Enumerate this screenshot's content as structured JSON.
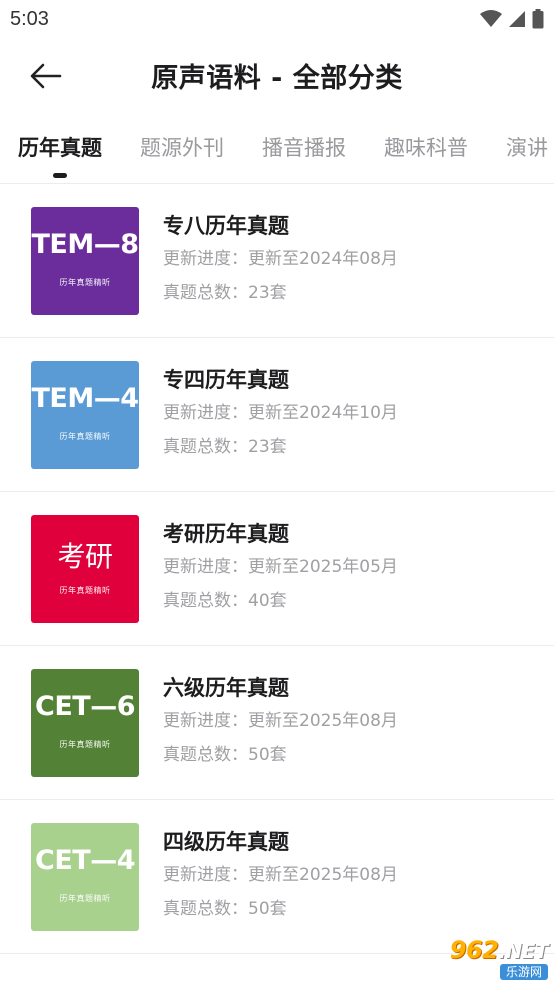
{
  "status_bar": {
    "time": "5:03"
  },
  "header": {
    "title": "原声语料 - 全部分类"
  },
  "tabs": [
    {
      "label": "历年真题",
      "active": true
    },
    {
      "label": "题源外刊",
      "active": false
    },
    {
      "label": "播音播报",
      "active": false
    },
    {
      "label": "趣味科普",
      "active": false
    },
    {
      "label": "演讲",
      "active": false
    }
  ],
  "items": [
    {
      "cover_title": "TEM—8",
      "cover_subtitle": "历年真题精听",
      "cover_color": "#6a2d9b",
      "title": "专八历年真题",
      "progress": "更新进度：更新至2024年08月",
      "count": "真题总数：23套"
    },
    {
      "cover_title": "TEM—4",
      "cover_subtitle": "历年真题精听",
      "cover_color": "#5b9bd5",
      "title": "专四历年真题",
      "progress": "更新进度：更新至2024年10月",
      "count": "真题总数：23套"
    },
    {
      "cover_title": "考研",
      "cover_subtitle": "历年真题精听",
      "cover_color": "#e0003b",
      "title": "考研历年真题",
      "progress": "更新进度：更新至2025年05月",
      "count": "真题总数：40套"
    },
    {
      "cover_title": "CET—6",
      "cover_subtitle": "历年真题精听",
      "cover_color": "#538135",
      "title": "六级历年真题",
      "progress": "更新进度：更新至2025年08月",
      "count": "真题总数：50套"
    },
    {
      "cover_title": "CET—4",
      "cover_subtitle": "历年真题精听",
      "cover_color": "#a9d18e",
      "title": "四级历年真题",
      "progress": "更新进度：更新至2025年08月",
      "count": "真题总数：50套"
    }
  ],
  "watermark": {
    "main": "962",
    "net": ".NET",
    "sub": "乐游网"
  }
}
